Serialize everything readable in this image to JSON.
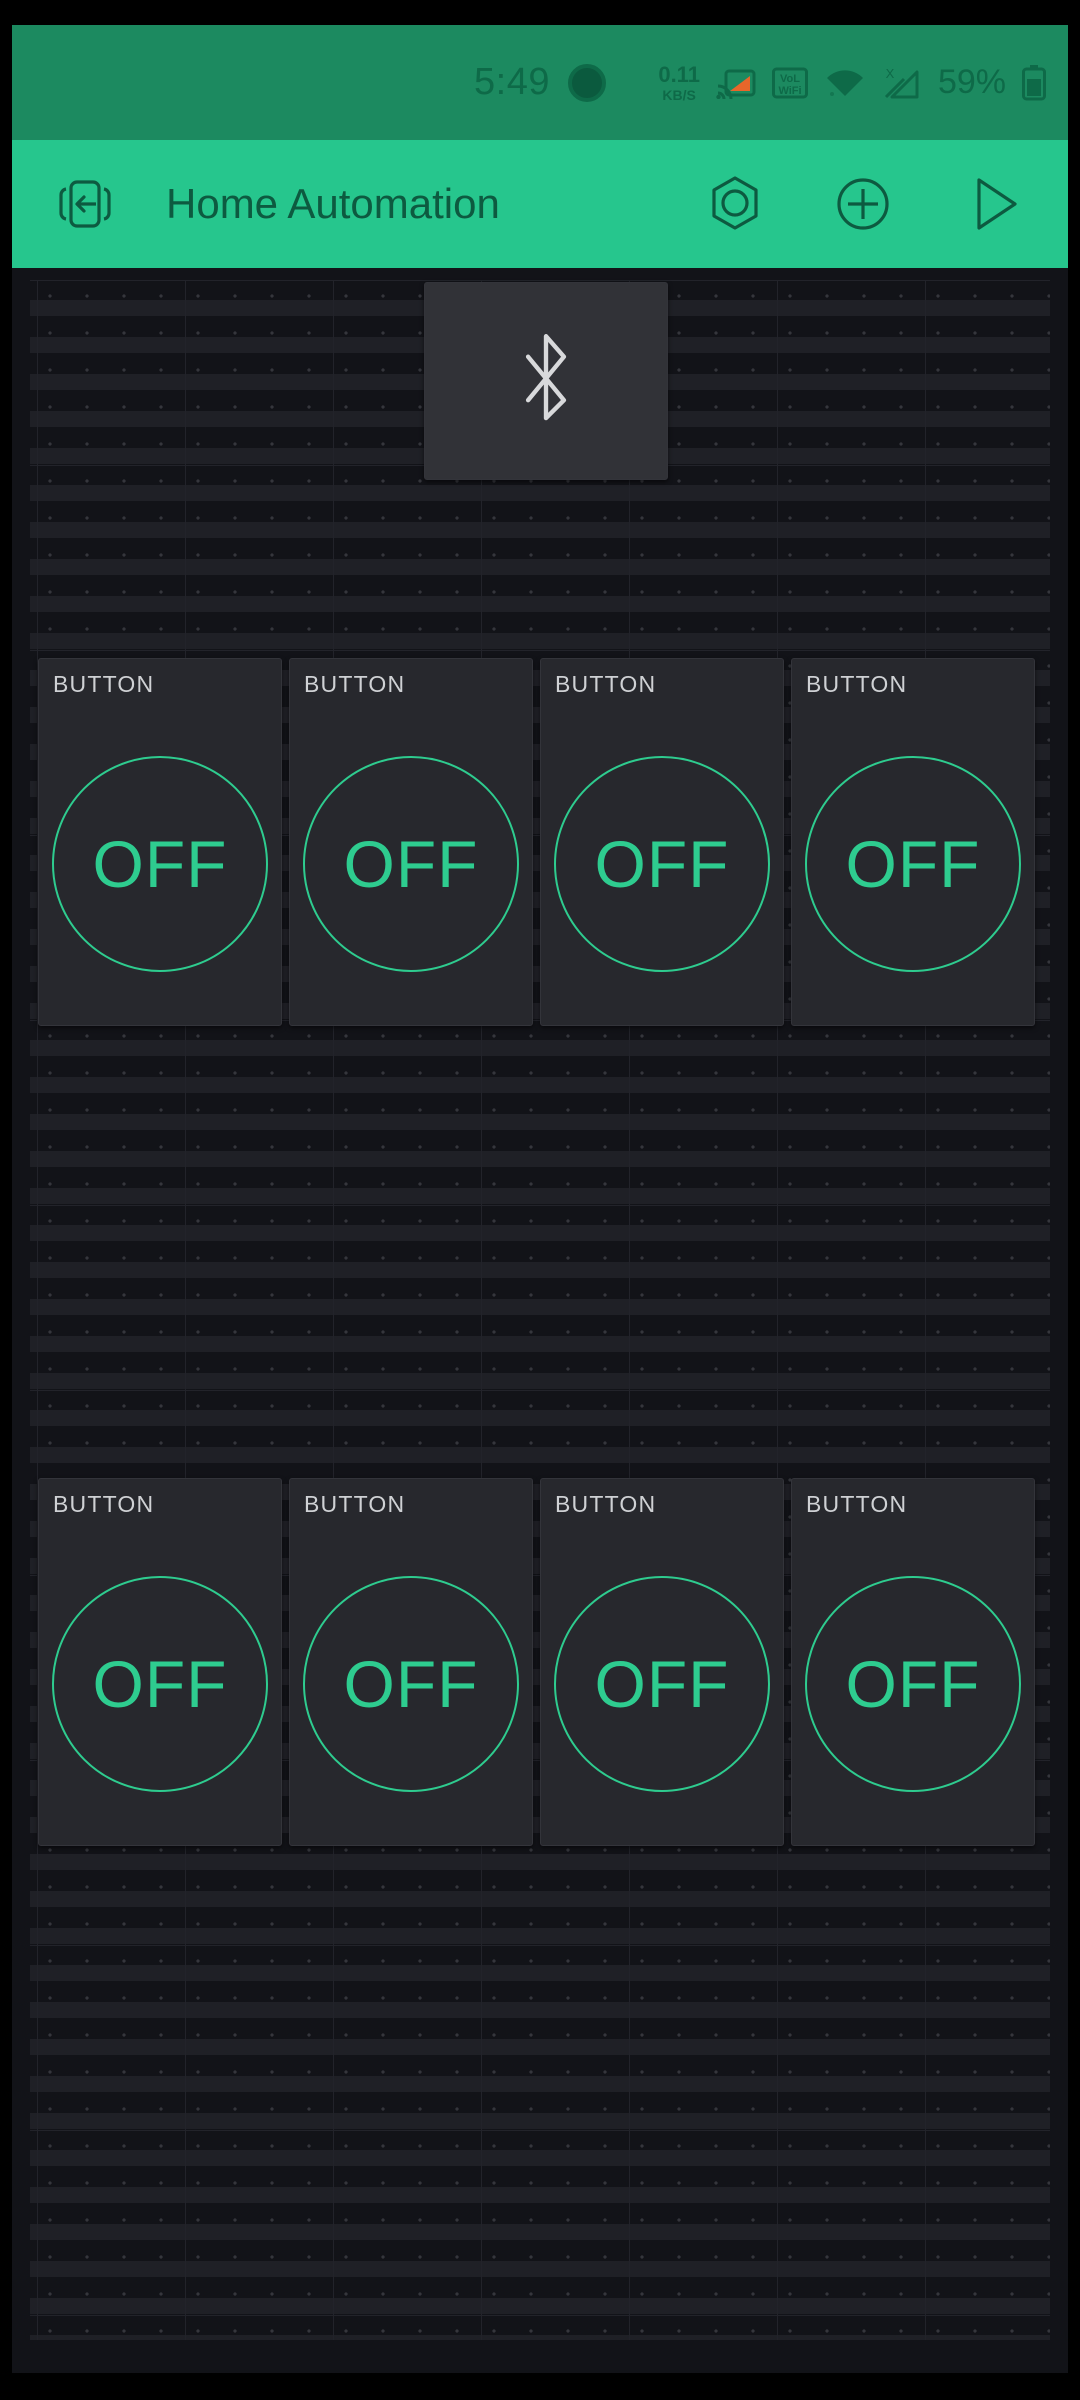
{
  "status_bar": {
    "time": "5:49",
    "punch_hole_icon": "camera-punch-hole",
    "net_speed_value": "0.11",
    "net_speed_unit": "KB/S",
    "icons": [
      "cast-screen-icon",
      "volte-wifi-icon",
      "wifi-icon",
      "mobile-signal-x-icon"
    ],
    "battery_percent": "59%",
    "battery_icon": "battery-icon",
    "background_color": "#1C8A60",
    "foreground_color": "#0E6A48"
  },
  "app_bar": {
    "back_icon": "exit-app-icon",
    "title": "Home Automation",
    "actions": [
      {
        "icon": "hex-nut-settings-icon",
        "label": "Settings"
      },
      {
        "icon": "plus-circle-icon",
        "label": "Add widget"
      },
      {
        "icon": "play-triangle-icon",
        "label": "Run"
      }
    ],
    "background_color": "#26C68D",
    "foreground_color": "#0D5A40"
  },
  "canvas": {
    "background_color": "#121318",
    "grid_dot_color": "#35363c",
    "accent_color": "#2ECC8F",
    "widget_background": "#27282D"
  },
  "widgets": {
    "bluetooth": {
      "type": "bluetooth-tile",
      "icon": "bluetooth-icon",
      "label": ""
    },
    "buttons_row1": [
      {
        "label": "BUTTON",
        "state": "OFF"
      },
      {
        "label": "BUTTON",
        "state": "OFF"
      },
      {
        "label": "BUTTON",
        "state": "OFF"
      },
      {
        "label": "BUTTON",
        "state": "OFF"
      }
    ],
    "buttons_row2": [
      {
        "label": "BUTTON",
        "state": "OFF"
      },
      {
        "label": "BUTTON",
        "state": "OFF"
      },
      {
        "label": "BUTTON",
        "state": "OFF"
      },
      {
        "label": "BUTTON",
        "state": "OFF"
      }
    ]
  }
}
